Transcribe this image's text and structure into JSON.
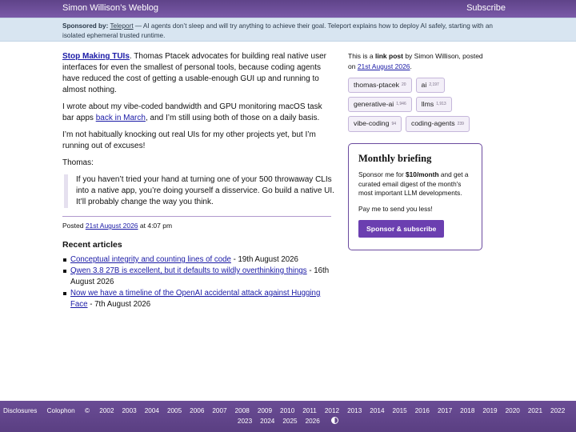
{
  "header": {
    "site_title": "Simon Willison’s Weblog",
    "subscribe": "Subscribe"
  },
  "sponsor": {
    "label": "Sponsored by:",
    "name": "Teleport",
    "text": " — AI agents don’t sleep and will try anything to achieve their goal. Teleport explains how to deploy AI safely, starting with an isolated ephemeral trusted runtime."
  },
  "post": {
    "lede_link": "Stop Making TUIs",
    "lede_text": ". Thomas Ptacek advocates for building real native user interfaces for even the smallest of personal tools, because coding agents have reduced the cost of getting a usable-enough GUI up and running to almost nothing.",
    "p2_before": "I wrote about my vibe-coded bandwidth and GPU monitoring macOS task bar apps ",
    "p2_link": "back in March",
    "p2_after": ", and I’m still using both of those on a daily basis.",
    "p3": "I’m not habitually knocking out real UIs for my other projects yet, but I’m running out of excuses!",
    "p4": "Thomas:",
    "quote": "If you haven’t tried your hand at turning one of your 500 throwaway CLIs into a native app, you’re doing yourself a disservice. Go build a native UI. It’ll probably change the way you think.",
    "posted_label": "Posted ",
    "posted_date": "21st August 2026",
    "posted_time": " at 4:07 pm"
  },
  "recent": {
    "heading": "Recent articles",
    "items": [
      {
        "title": "Conceptual integrity and counting lines of code",
        "date": " - 19th August 2026"
      },
      {
        "title": "Qwen 3.8 27B is excellent, but it defaults to wildly overthinking things",
        "date": " - 16th August 2026"
      },
      {
        "title": "Now we have a timeline of the OpenAI accidental attack against Hugging Face",
        "date": " - 7th August 2026"
      }
    ]
  },
  "sidebar": {
    "info_1": "This is a ",
    "info_bold": "link post",
    "info_2": " by Simon Willison, posted on ",
    "info_date": "21st August 2026",
    "info_3": ".",
    "tags": [
      {
        "name": "thomas-ptacek",
        "count": "20"
      },
      {
        "name": "ai",
        "count": "2,197"
      },
      {
        "name": "generative-ai",
        "count": "1,946"
      },
      {
        "name": "llms",
        "count": "1,913"
      },
      {
        "name": "vibe-coding",
        "count": "94"
      },
      {
        "name": "coding-agents",
        "count": "239"
      }
    ]
  },
  "briefing": {
    "title": "Monthly briefing",
    "text_1": "Sponsor me for ",
    "price": "$10/month",
    "text_2": " and get a curated email digest of the month's most important LLM developments.",
    "pay": "Pay me to send you less!",
    "button": "Sponsor & subscribe"
  },
  "footer": {
    "disclosures": "Disclosures",
    "colophon": "Colophon",
    "copyright": "©",
    "years_row1": [
      "2002",
      "2003",
      "2004",
      "2005",
      "2006",
      "2007",
      "2008",
      "2009",
      "2010",
      "2011",
      "2012",
      "2013",
      "2014",
      "2015",
      "2016",
      "2017",
      "2018",
      "2019",
      "2020",
      "2021",
      "2022"
    ],
    "years_row2": [
      "2023",
      "2024",
      "2025",
      "2026"
    ]
  }
}
